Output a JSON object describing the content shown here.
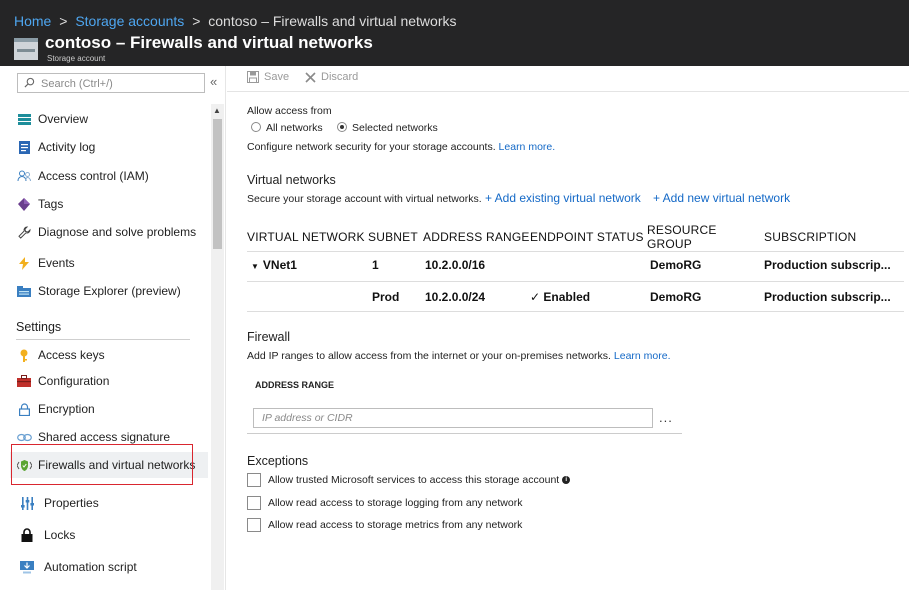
{
  "breadcrumb": {
    "home": "Home",
    "sep1": ">",
    "storage_accounts": "Storage accounts",
    "sep2": ">",
    "current": "contoso – Firewalls and virtual networks"
  },
  "header": {
    "title": "contoso – Firewalls and virtual networks",
    "subtitle": "Storage account"
  },
  "sidebar": {
    "search_placeholder": "Search (Ctrl+/)",
    "collapse": "«",
    "items": [
      {
        "label": "Overview",
        "icon": "overview-icon"
      },
      {
        "label": "Activity log",
        "icon": "activity-log-icon"
      },
      {
        "label": "Access control (IAM)",
        "icon": "people-icon"
      },
      {
        "label": "Tags",
        "icon": "tag-icon"
      },
      {
        "label": "Diagnose and solve problems",
        "icon": "wrench-icon"
      },
      {
        "label": "Events",
        "icon": "lightning-icon"
      },
      {
        "label": "Storage Explorer (preview)",
        "icon": "storage-explorer-icon"
      }
    ],
    "settings_label": "Settings",
    "settings_items": [
      {
        "label": "Access keys",
        "icon": "key-icon"
      },
      {
        "label": "Configuration",
        "icon": "toolbox-icon"
      },
      {
        "label": "Encryption",
        "icon": "lock-outline-icon"
      },
      {
        "label": "Shared access signature",
        "icon": "link-icon"
      },
      {
        "label": "Firewalls and virtual networks",
        "icon": "firewall-icon"
      },
      {
        "label": "Properties",
        "icon": "properties-icon"
      },
      {
        "label": "Locks",
        "icon": "lock-icon"
      },
      {
        "label": "Automation script",
        "icon": "download-icon"
      }
    ]
  },
  "toolbar": {
    "save": "Save",
    "discard": "Discard"
  },
  "access": {
    "label": "Allow access from",
    "all_networks": "All networks",
    "selected_networks": "Selected networks",
    "selected": "selected_networks",
    "description": "Configure network security for your storage accounts.",
    "learn_more": "Learn more."
  },
  "virtual_networks": {
    "heading": "Virtual networks",
    "description": "Secure your storage account with virtual networks.",
    "add_existing": "+ Add existing virtual network",
    "add_new": "+ Add new virtual network",
    "columns": [
      "VIRTUAL NETWORK",
      "SUBNET",
      "ADDRESS RANGE",
      "ENDPOINT STATUS",
      "RESOURCE GROUP",
      "SUBSCRIPTION"
    ],
    "rows": [
      {
        "vnet": "VNet1",
        "subnet": "1",
        "address_range": "10.2.0.0/16",
        "endpoint_status": "",
        "resource_group": "DemoRG",
        "subscription": "Production subscrip..."
      },
      {
        "vnet": "",
        "subnet": "Prod",
        "address_range": "10.2.0.0/24",
        "endpoint_status": "Enabled",
        "resource_group": "DemoRG",
        "subscription": "Production subscrip..."
      }
    ]
  },
  "firewall": {
    "heading": "Firewall",
    "description": "Add IP ranges to allow access from the internet or your on-premises networks.",
    "learn_more": "Learn more.",
    "address_range_label": "ADDRESS RANGE",
    "ip_placeholder": "IP address or CIDR",
    "more": "..."
  },
  "exceptions": {
    "heading": "Exceptions",
    "items": [
      {
        "label": "Allow trusted Microsoft services to access this storage account",
        "checked": false
      },
      {
        "label": "Allow read access to storage logging from any network",
        "checked": false
      },
      {
        "label": "Allow read access to storage metrics from any network",
        "checked": false
      }
    ]
  },
  "colors": {
    "header_bg": "#252526",
    "link": "#1469c7",
    "highlight": "#d9262f"
  }
}
